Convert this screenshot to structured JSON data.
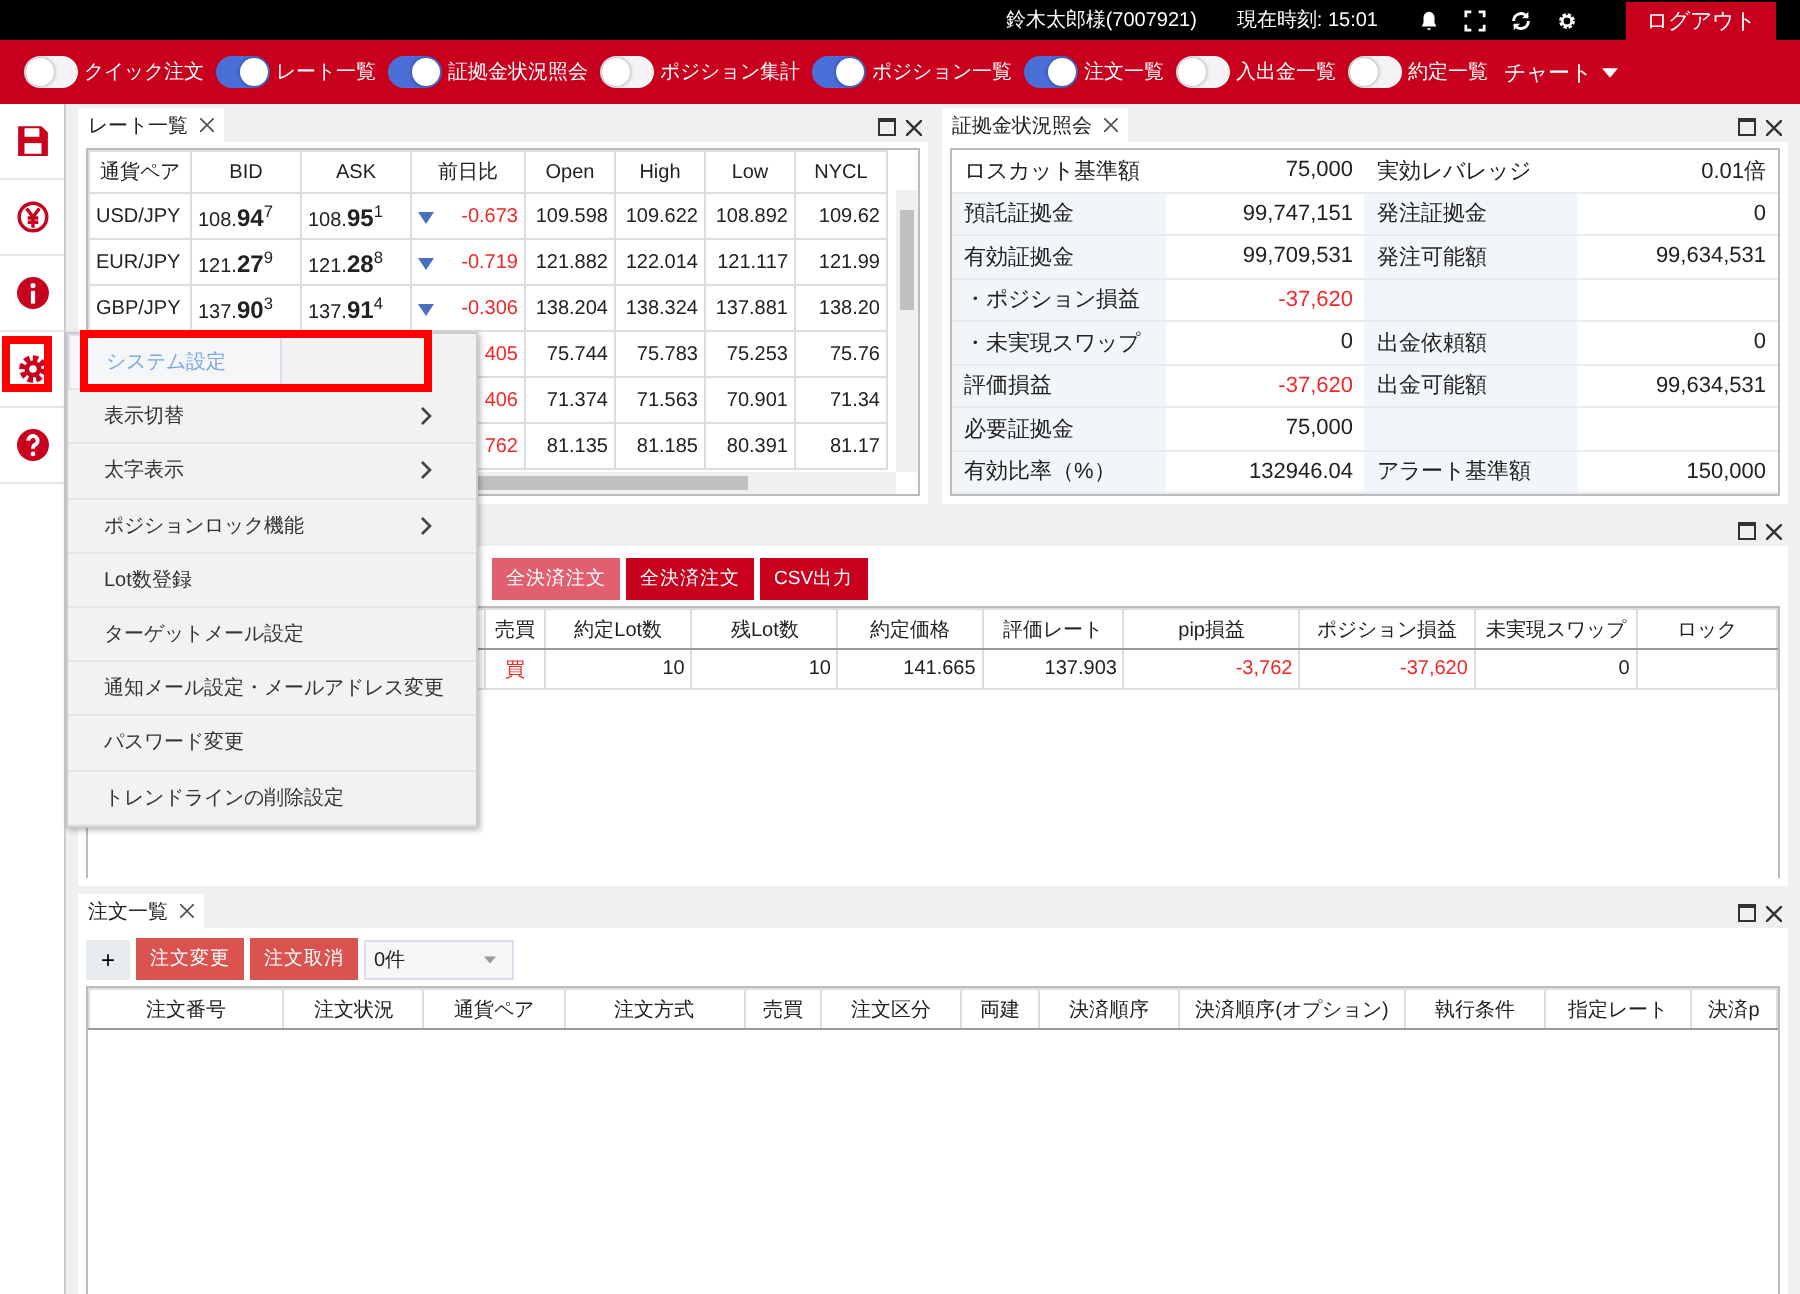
{
  "header": {
    "user": "鈴木太郎様(7007921)",
    "clock": "現在時刻: 15:01",
    "logout": "ログアウト"
  },
  "toolbar": {
    "toggles": [
      {
        "label": "クイック注文",
        "on": false
      },
      {
        "label": "レート一覧",
        "on": true
      },
      {
        "label": "証拠金状況照会",
        "on": true
      },
      {
        "label": "ポジション集計",
        "on": false
      },
      {
        "label": "ポジション一覧",
        "on": true
      },
      {
        "label": "注文一覧",
        "on": true
      },
      {
        "label": "入出金一覧",
        "on": false
      },
      {
        "label": "約定一覧",
        "on": false
      }
    ],
    "chart": "チャート"
  },
  "rate_panel": {
    "title": "レート一覧",
    "columns": [
      "通貨ペア",
      "BID",
      "ASK",
      "前日比",
      "Open",
      "High",
      "Low",
      "NYCL"
    ],
    "rows": [
      {
        "pair": "USD/JPY",
        "bid": "108.**94**$^{7}$",
        "ask": "108.**95**$^{1}$",
        "falling": true,
        "change": "-0.673",
        "open": "109.598",
        "high": "109.622",
        "low": "108.892",
        "nycl": "109.62"
      },
      {
        "pair": "EUR/JPY",
        "bid": "121.**27**$^{9}$",
        "ask": "121.**28**$^{8}$",
        "falling": true,
        "change": "-0.719",
        "open": "121.882",
        "high": "122.014",
        "low": "121.117",
        "nycl": "121.99"
      },
      {
        "pair": "GBP/JPY",
        "bid": "137.**90**$^{3}$",
        "ask": "137.**91**$^{4}$",
        "falling": true,
        "change": "-0.306",
        "open": "138.204",
        "high": "138.324",
        "low": "137.881",
        "nycl": "138.20"
      },
      {
        "change": "405",
        "open": "75.744",
        "high": "75.783",
        "low": "75.253",
        "nycl": "75.76"
      },
      {
        "change": "406",
        "open": "71.374",
        "high": "71.563",
        "low": "70.901",
        "nycl": "71.34"
      },
      {
        "change": "762",
        "open": "81.135",
        "high": "81.185",
        "low": "80.391",
        "nycl": "81.17"
      }
    ]
  },
  "margin_panel": {
    "title": "証拠金状況照会",
    "rows": [
      {
        "label": "ロスカット基準額",
        "value": "75,000",
        "negative": false,
        "label2": "実効レバレッジ",
        "value2": "0.01倍"
      },
      {
        "label": "預託証拠金",
        "value": "99,747,151",
        "negative": false,
        "label2": "発注証拠金",
        "value2": "0"
      },
      {
        "label": "有効証拠金",
        "value": "99,709,531",
        "negative": false,
        "label2": "発注可能額",
        "value2": "99,634,531"
      },
      {
        "label": "・ポジション損益",
        "value": "-37,620",
        "negative": true
      },
      {
        "label": "・未実現スワップ",
        "value": "0",
        "negative": false,
        "label2": "出金依頼額",
        "value2": "0"
      },
      {
        "label": "評価損益",
        "value": "-37,620",
        "negative": true,
        "label2": "出金可能額",
        "value2": "99,634,531"
      },
      {
        "label": "必要証拠金",
        "value": "75,000",
        "negative": false
      },
      {
        "label": "有効比率（%）",
        "value": "132946.04",
        "negative": false,
        "label2": "アラート基準額",
        "value2": "150,000"
      }
    ]
  },
  "position_panel": {
    "buttons": [
      "全決済注文",
      "全決済注文",
      "CSV出力"
    ],
    "columns": [
      "売買",
      "約定Lot数",
      "残Lot数",
      "約定価格",
      "評価レート",
      "pip損益",
      "ポジション損益",
      "未実現スワップ",
      "ロック"
    ],
    "rows": [
      [
        {
          "text": "買",
          "alert": true
        },
        {
          "text": "10",
          "alert": false
        },
        {
          "text": "10",
          "alert": false
        },
        {
          "text": "141.665",
          "alert": false
        },
        {
          "text": "137.903",
          "alert": false
        },
        {
          "text": "-3,762",
          "alert": true
        },
        {
          "text": "-37,620",
          "alert": true
        },
        {
          "text": "0",
          "alert": false
        }
      ]
    ]
  },
  "order_panel": {
    "title": "注文一覧",
    "add": "+",
    "buttons": [
      "注文変更",
      "注文取消"
    ],
    "count": "0件",
    "columns": [
      "注文番号",
      "注文状況",
      "通貨ペア",
      "注文方式",
      "売買",
      "注文区分",
      "両建",
      "決済順序",
      "決済順序(オプション)",
      "執行条件",
      "指定レート",
      "決済p"
    ]
  },
  "settings_menu": {
    "items": [
      {
        "label": "システム設定",
        "submenu": false,
        "selected": true
      },
      {
        "label": "表示切替",
        "submenu": true,
        "selected": false
      },
      {
        "label": "太字表示",
        "submenu": true,
        "selected": false
      },
      {
        "label": "ポジションロック機能",
        "submenu": true,
        "selected": false
      },
      {
        "label": "Lot数登録",
        "submenu": false,
        "selected": false
      },
      {
        "label": "ターゲットメール設定",
        "submenu": false,
        "selected": false
      },
      {
        "label": "通知メール設定・メールアドレス変更",
        "submenu": false,
        "selected": false
      },
      {
        "label": "パスワード変更",
        "submenu": false,
        "selected": false
      },
      {
        "label": "トレンドラインの削除設定",
        "submenu": false,
        "selected": false
      }
    ]
  }
}
